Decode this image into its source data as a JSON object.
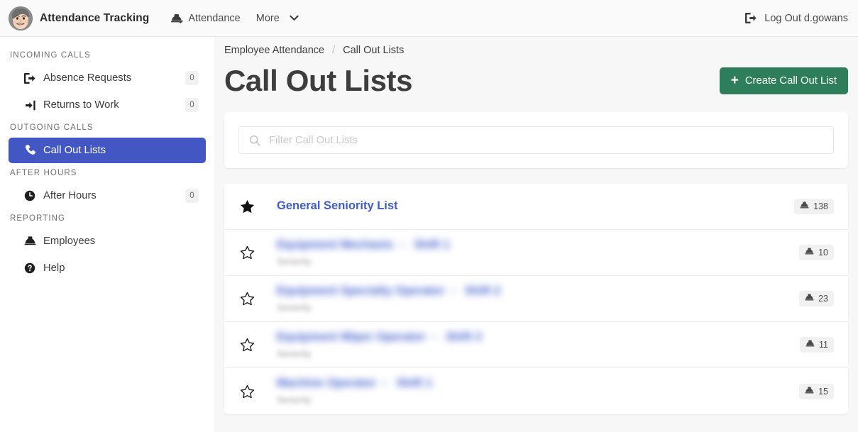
{
  "navbar": {
    "brand_name": "Attendance Tracking",
    "avatar_icon": "user-avatar-face",
    "links": [
      {
        "label": "Attendance",
        "icon": "hard-hat-check-icon",
        "has_chevron": false
      },
      {
        "label": "More",
        "icon": "",
        "has_chevron": true
      }
    ],
    "logout": {
      "label": "Log Out d.gowans",
      "icon": "logout-icon"
    }
  },
  "sidebar": {
    "sections": [
      {
        "title": "INCOMING CALLS",
        "items": [
          {
            "label": "Absence Requests",
            "icon": "sign-out-icon",
            "badge": "0",
            "active": false
          },
          {
            "label": "Returns to Work",
            "icon": "sign-in-icon",
            "badge": "0",
            "active": false
          }
        ]
      },
      {
        "title": "OUTGOING CALLS",
        "items": [
          {
            "label": "Call Out Lists",
            "icon": "phone-icon",
            "badge": "",
            "active": true
          }
        ]
      },
      {
        "title": "AFTER HOURS",
        "items": [
          {
            "label": "After Hours",
            "icon": "clock-icon",
            "badge": "0",
            "active": false
          }
        ]
      },
      {
        "title": "REPORTING",
        "items": [
          {
            "label": "Employees",
            "icon": "hard-hat-icon",
            "badge": "",
            "active": false
          },
          {
            "label": "Help",
            "icon": "question-circle-icon",
            "badge": "",
            "active": false
          }
        ]
      }
    ]
  },
  "main": {
    "breadcrumb": {
      "parent": "Employee Attendance",
      "separator": "/",
      "current": "Call Out Lists"
    },
    "page_title": "Call Out Lists",
    "create_button": {
      "label": "Create Call Out List",
      "icon": "plus-icon"
    },
    "search": {
      "placeholder": "Filter Call Out Lists",
      "value": "",
      "icon": "search-icon"
    },
    "rows": [
      {
        "title": "General Seniority List",
        "subtitle": "",
        "employee_count": "138",
        "starred": true,
        "redacted": false
      },
      {
        "title": "",
        "subtitle": "",
        "employee_count": "10",
        "starred": false,
        "redacted": true
      },
      {
        "title": "",
        "subtitle": "",
        "employee_count": "23",
        "starred": false,
        "redacted": true
      },
      {
        "title": "",
        "subtitle": "",
        "employee_count": "11",
        "starred": false,
        "redacted": true
      },
      {
        "title": "",
        "subtitle": "",
        "employee_count": "15",
        "starred": false,
        "redacted": true
      }
    ]
  },
  "colors": {
    "accent_blue": "#4257c4",
    "link_blue": "#3f5ccc",
    "create_green": "#2e7d5b",
    "page_bg": "#f7f7f8"
  }
}
